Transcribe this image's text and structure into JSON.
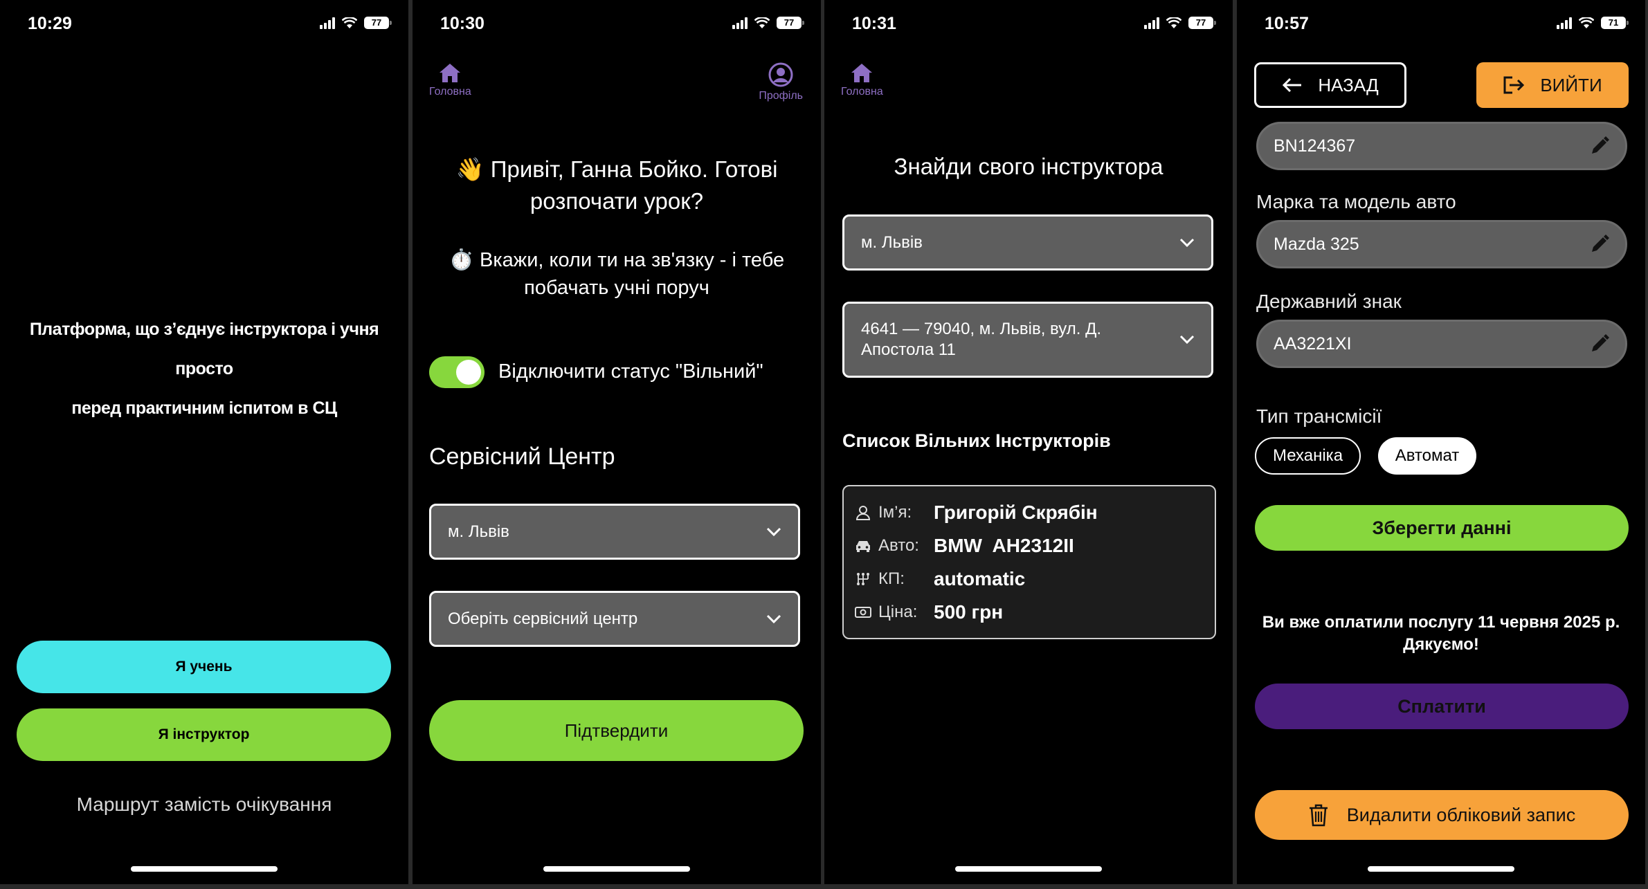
{
  "screen1": {
    "time": "10:29",
    "battery": "77",
    "tagline_line1": "Платформа, що з’єднує інструктора і учня просто",
    "tagline_line2": "перед практичним іспитом в СЦ",
    "student_button": "Я учень",
    "instructor_button": "Я інструктор",
    "slogan": "Маршрут замість очікування"
  },
  "screen2": {
    "time": "10:30",
    "battery": "77",
    "nav_home": "Головна",
    "nav_profile": "Профіль",
    "greeting_line1": "👋 Привіт, Ганна Бойко. Готові",
    "greeting_line2": "розпочати урок?",
    "hint_line1": "⏱️ Вкажи, коли ти на зв'язку - і тебе",
    "hint_line2": "побачать учні поруч",
    "toggle_label": "Відключити статус \"Вільний\"",
    "section_title": "Сервісний Центр",
    "city_select": "м. Львів",
    "center_select": "Оберіть сервісний центр",
    "confirm_button": "Підтвердити"
  },
  "screen3": {
    "time": "10:31",
    "battery": "77",
    "nav_home": "Головна",
    "title": "Знайди свого інструктора",
    "city_select": "м. Львів",
    "center_line1": "4641 — 79040, м. Львів, вул. Д.",
    "center_line2": "Апостола 11",
    "list_title": "Список Вільних Інструкторів",
    "card": {
      "name_label": "Ім’я:",
      "name": "Григорій Скрябін",
      "car_label": "Авто:",
      "car": "BMW  AH2312II",
      "gear_label": "КП:",
      "gear": "automatic",
      "price_label": "Ціна:",
      "price": "500 грн"
    }
  },
  "screen4": {
    "time": "10:57",
    "battery": "71",
    "back_button": "НАЗАД",
    "logout_button": "ВИЙТИ",
    "license_value": "BN124367",
    "car_label": "Марка та модель авто",
    "car_value": "Mazda 325",
    "plate_label": "Державний знак",
    "plate_value": "AA3221XI",
    "transmission_label": "Тип трансмісії",
    "manual_option": "Механіка",
    "auto_option": "Автомат",
    "save_button": "Зберегти данні",
    "paid_line1": "Ви вже оплатили послугу 11 червня 2025 р.",
    "paid_line2": "Дякуємо!",
    "pay_button": "Сплатити",
    "delete_button": "Видалити обліковий запис"
  },
  "colors": {
    "cyan": "#46e5e8",
    "green": "#87d73d",
    "orange": "#f7a23a",
    "purple": "#4a1d7c",
    "nav_purple": "#8e6fc4"
  },
  "icons": [
    "signal-icon",
    "wifi-icon",
    "battery-icon",
    "home-icon",
    "profile-icon",
    "chevron-down-icon",
    "user-icon",
    "car-icon",
    "gearbox-icon",
    "money-icon",
    "arrow-left-icon",
    "logout-icon",
    "pencil-icon",
    "trash-icon"
  ]
}
